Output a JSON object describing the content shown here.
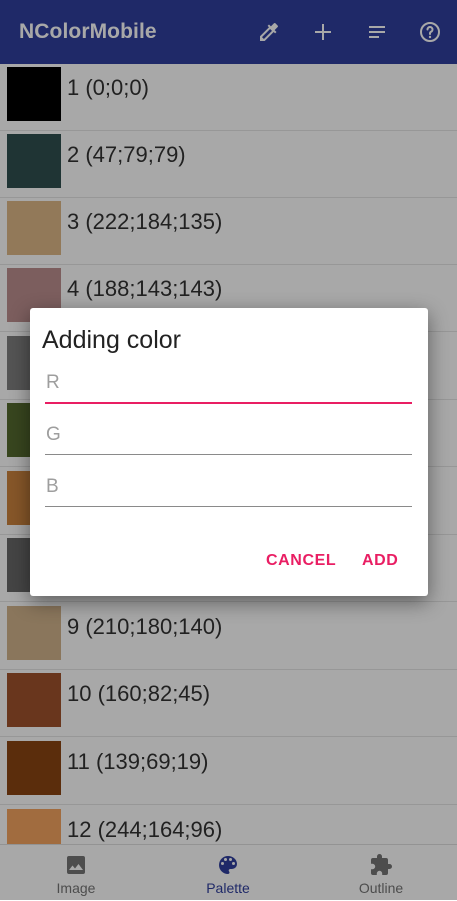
{
  "app_bar": {
    "title": "NColorMobile",
    "background": "#303f9f",
    "actions": [
      {
        "name": "eyedropper-icon"
      },
      {
        "name": "add-icon"
      },
      {
        "name": "sort-icon"
      },
      {
        "name": "help-icon"
      }
    ]
  },
  "palette": {
    "items": [
      {
        "label": "1 (0;0;0)",
        "color": "#000000"
      },
      {
        "label": "2 (47;79;79)",
        "color": "#2f4f4f"
      },
      {
        "label": "3 (222;184;135)",
        "color": "#deb887"
      },
      {
        "label": "4 (188;143;143)",
        "color": "#bc8f8f"
      },
      {
        "label": "",
        "color": "#808080"
      },
      {
        "label": "",
        "color": "#556b2f"
      },
      {
        "label": "",
        "color": "#cd853f"
      },
      {
        "label": "",
        "color": "#696969"
      },
      {
        "label": "9 (210;180;140)",
        "color": "#d2b48c"
      },
      {
        "label": "10 (160;82;45)",
        "color": "#a0522d"
      },
      {
        "label": "11 (139;69;19)",
        "color": "#8b4513"
      },
      {
        "label": "12 (244;164;96)",
        "color": "#f4a460"
      }
    ]
  },
  "dialog": {
    "title": "Adding color",
    "fields": [
      {
        "placeholder": "R",
        "value": ""
      },
      {
        "placeholder": "G",
        "value": ""
      },
      {
        "placeholder": "B",
        "value": ""
      }
    ],
    "cancel_label": "CANCEL",
    "add_label": "ADD",
    "accent": "#e91e63"
  },
  "bottom_nav": {
    "items": [
      {
        "label": "Image",
        "icon": "image-icon"
      },
      {
        "label": "Palette",
        "icon": "palette-icon",
        "active": true
      },
      {
        "label": "Outline",
        "icon": "puzzle-icon"
      }
    ]
  }
}
